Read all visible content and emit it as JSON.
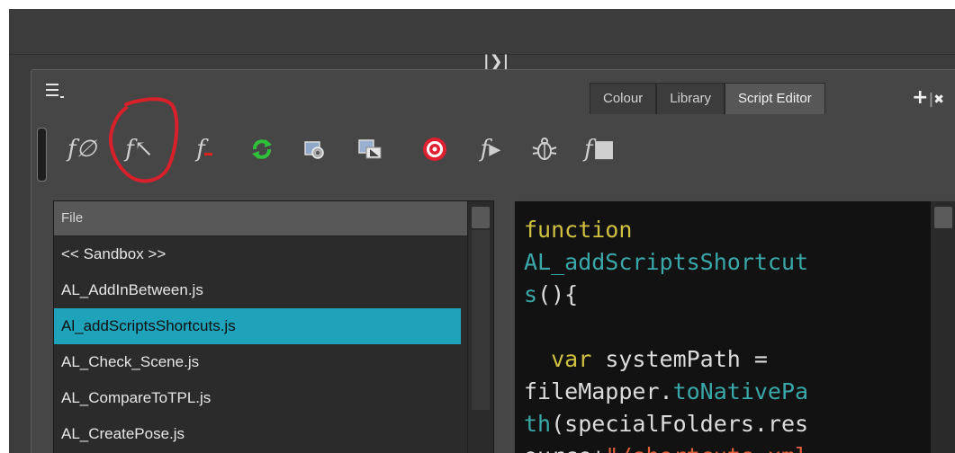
{
  "tabs": [
    {
      "label": "Colour",
      "active": false
    },
    {
      "label": "Library",
      "active": false
    },
    {
      "label": "Script Editor",
      "active": true
    }
  ],
  "tab_actions": {
    "add": "+",
    "close": "✖"
  },
  "collapse_glyph": "|❯|",
  "toolbar": {
    "icons": [
      "new-script-icon",
      "import-script-icon",
      "delete-script-icon",
      "refresh-icon",
      "set-target-icon",
      "run-configuration-icon",
      "target-icon",
      "run-icon",
      "debug-icon",
      "stop-icon"
    ],
    "glyphs": {
      "new": "f∅",
      "import": "f↖",
      "delete": "f",
      "run": "f▸",
      "debug": "🐞",
      "stop": "f■"
    }
  },
  "file_list": {
    "header": "File",
    "items": [
      {
        "label": "<< Sandbox >>",
        "selected": false
      },
      {
        "label": "AL_AddInBetween.js",
        "selected": false
      },
      {
        "label": "Al_addScriptsShortcuts.js",
        "selected": true
      },
      {
        "label": "AL_Check_Scene.js",
        "selected": false
      },
      {
        "label": "AL_CompareToTPL.js",
        "selected": false
      },
      {
        "label": "AL_CreatePose.js",
        "selected": false
      }
    ]
  },
  "editor": {
    "lines": [
      [
        {
          "t": "function",
          "c": "kw"
        }
      ],
      [
        {
          "t": "AL_addScriptsShortcut",
          "c": "fn"
        }
      ],
      [
        {
          "t": "s",
          "c": "fn"
        },
        {
          "t": "(){",
          "c": "pl"
        }
      ],
      [
        {
          "t": "",
          "c": "pl"
        }
      ],
      [
        {
          "t": "  ",
          "c": "pl"
        },
        {
          "t": "var",
          "c": "kw"
        },
        {
          "t": " systemPath =",
          "c": "pl"
        }
      ],
      [
        {
          "t": "fileMapper.",
          "c": "pl"
        },
        {
          "t": "toNativePa",
          "c": "fn"
        }
      ],
      [
        {
          "t": "th",
          "c": "fn"
        },
        {
          "t": "(specialFolders.res",
          "c": "pl"
        }
      ],
      [
        {
          "t": "ource+",
          "c": "pl"
        },
        {
          "t": "\"/shortcuts.xml",
          "c": "st"
        }
      ]
    ]
  },
  "colors": {
    "selection": "#1ea3bb",
    "keyword": "#d0c040",
    "function": "#3aa8a8",
    "string": "#e0603c",
    "annotation": "#d8202a"
  }
}
